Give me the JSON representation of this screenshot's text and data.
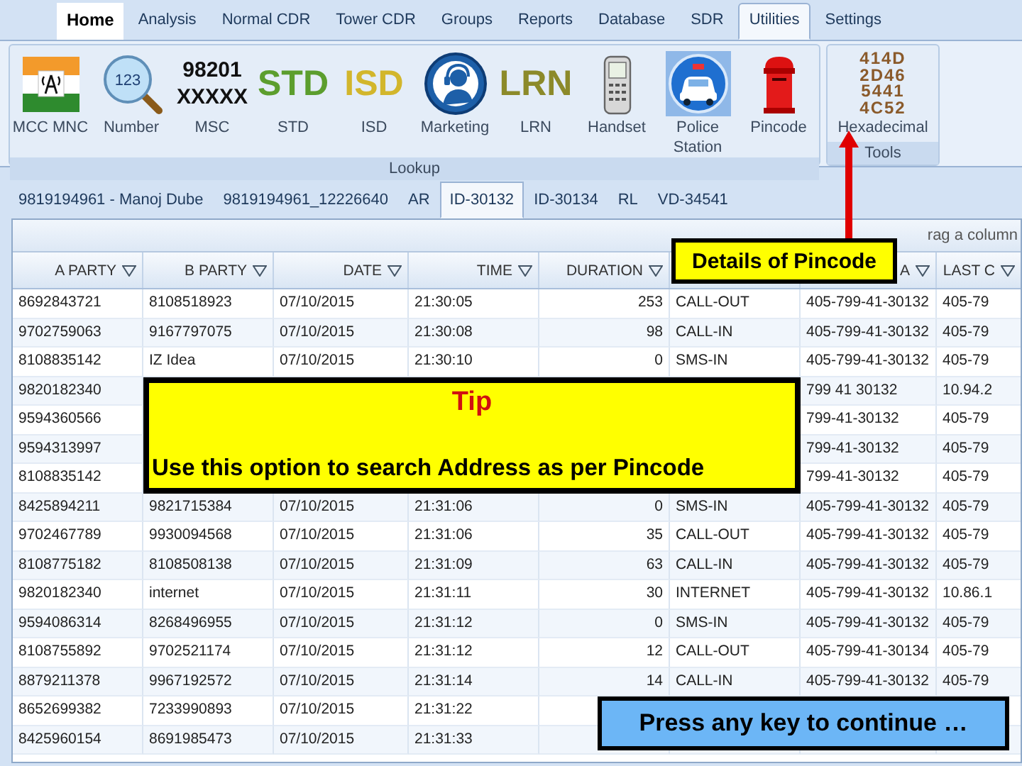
{
  "menu_tabs": [
    {
      "label": "Home",
      "selected": false,
      "highlighted": true
    },
    {
      "label": "Analysis",
      "selected": false,
      "highlighted": false
    },
    {
      "label": "Normal CDR",
      "selected": false,
      "highlighted": false
    },
    {
      "label": "Tower CDR",
      "selected": false,
      "highlighted": false
    },
    {
      "label": "Groups",
      "selected": false,
      "highlighted": false
    },
    {
      "label": "Reports",
      "selected": false,
      "highlighted": false
    },
    {
      "label": "Database",
      "selected": false,
      "highlighted": false
    },
    {
      "label": "SDR",
      "selected": false,
      "highlighted": false
    },
    {
      "label": "Utilities",
      "selected": true,
      "highlighted": false
    },
    {
      "label": "Settings",
      "selected": false,
      "highlighted": false
    }
  ],
  "ribbon_groups": [
    {
      "label": "Lookup",
      "buttons": [
        {
          "label": "MCC MNC",
          "kind": "flag"
        },
        {
          "label": "Number",
          "kind": "magnifier",
          "icon_text": [
            "123"
          ]
        },
        {
          "label": "MSC",
          "kind": "digits",
          "icon_text": [
            "98201",
            "XXXXX"
          ]
        },
        {
          "label": "STD",
          "kind": "lettering",
          "icon_text": [
            "STD"
          ],
          "color": "#5c9e2e"
        },
        {
          "label": "ISD",
          "kind": "lettering",
          "icon_text": [
            "ISD"
          ],
          "color": "#d2b62c"
        },
        {
          "label": "Marketing",
          "kind": "headset"
        },
        {
          "label": "LRN",
          "kind": "lettering",
          "icon_text": [
            "LRN"
          ],
          "color": "#8c8a2a"
        },
        {
          "label": "Handset",
          "kind": "handset"
        },
        {
          "label": "Police Station",
          "kind": "car"
        },
        {
          "label": "Pincode",
          "kind": "postbox"
        }
      ]
    },
    {
      "label": "Tools",
      "buttons": [
        {
          "label": "Hexadecimal",
          "kind": "hexgrid",
          "icon_text": [
            "414D",
            "2D46",
            "5441",
            "4C52"
          ]
        }
      ]
    }
  ],
  "document_tabs": [
    {
      "label": "9819194961 - Manoj Dube",
      "selected": false
    },
    {
      "label": "9819194961_12226640",
      "selected": false
    },
    {
      "label": "AR",
      "selected": false
    },
    {
      "label": "ID-30132",
      "selected": true
    },
    {
      "label": "ID-30134",
      "selected": false
    },
    {
      "label": "RL",
      "selected": false
    },
    {
      "label": "VD-34541",
      "selected": false
    }
  ],
  "grid": {
    "group_panel_hint": "rag a column",
    "columns": {
      "a_party": "A PARTY",
      "b_party": "B PARTY",
      "date": "DATE",
      "time": "TIME",
      "duration": "DURATION",
      "column_7": "A",
      "column_8": "LAST C"
    },
    "rows": [
      {
        "a_party": "8692843721",
        "b_party": "8108518923",
        "date": "07/10/2015",
        "time": "21:30:05",
        "duration": "253",
        "column_6": "CALL-OUT",
        "column_7": "405-799-41-30132",
        "column_8": "405-79"
      },
      {
        "a_party": "9702759063",
        "b_party": "9167797075",
        "date": "07/10/2015",
        "time": "21:30:08",
        "duration": "98",
        "column_6": "CALL-IN",
        "column_7": "405-799-41-30132",
        "column_8": "405-79"
      },
      {
        "a_party": "8108835142",
        "b_party": "IZ Idea",
        "date": "07/10/2015",
        "time": "21:30:10",
        "duration": "0",
        "column_6": "SMS-IN",
        "column_7": "405-799-41-30132",
        "column_8": "405-79"
      },
      {
        "a_party": "9820182340",
        "column_7": "799 41 30132",
        "column_8": "10.94.2"
      },
      {
        "a_party": "9594360566",
        "column_7": "799-41-30132",
        "column_8": "405-79"
      },
      {
        "a_party": "9594313997",
        "column_7": "799-41-30132",
        "column_8": "405-79"
      },
      {
        "a_party": "8108835142",
        "column_7": "799-41-30132",
        "column_8": "405-79"
      },
      {
        "a_party": "8425894211",
        "b_party": "9821715384",
        "date": "07/10/2015",
        "time": "21:31:06",
        "duration": "0",
        "column_6": "SMS-IN",
        "column_7": "405-799-41-30132",
        "column_8": "405-79"
      },
      {
        "a_party": "9702467789",
        "b_party": "9930094568",
        "date": "07/10/2015",
        "time": "21:31:06",
        "duration": "35",
        "column_6": "CALL-OUT",
        "column_7": "405-799-41-30132",
        "column_8": "405-79"
      },
      {
        "a_party": "8108775182",
        "b_party": "8108508138",
        "date": "07/10/2015",
        "time": "21:31:09",
        "duration": "63",
        "column_6": "CALL-IN",
        "column_7": "405-799-41-30132",
        "column_8": "405-79"
      },
      {
        "a_party": "9820182340",
        "b_party": "internet",
        "date": "07/10/2015",
        "time": "21:31:11",
        "duration": "30",
        "column_6": "INTERNET",
        "column_7": "405-799-41-30132",
        "column_8": "10.86.1"
      },
      {
        "a_party": "9594086314",
        "b_party": "8268496955",
        "date": "07/10/2015",
        "time": "21:31:12",
        "duration": "0",
        "column_6": "SMS-IN",
        "column_7": "405-799-41-30132",
        "column_8": "405-79"
      },
      {
        "a_party": "8108755892",
        "b_party": "9702521174",
        "date": "07/10/2015",
        "time": "21:31:12",
        "duration": "12",
        "column_6": "CALL-OUT",
        "column_7": "405-799-41-30134",
        "column_8": "405-79"
      },
      {
        "a_party": "8879211378",
        "b_party": "9967192572",
        "date": "07/10/2015",
        "time": "21:31:14",
        "duration": "14",
        "column_6": "CALL-IN",
        "column_7": "405-799-41-30132",
        "column_8": "405-79"
      },
      {
        "a_party": "8652699382",
        "b_party": "7233990893",
        "date": "07/10/2015",
        "time": "21:31:22"
      },
      {
        "a_party": "8425960154",
        "b_party": "8691985473",
        "date": "07/10/2015",
        "time": "21:31:33"
      }
    ]
  },
  "callouts": {
    "details": "Details of Pincode",
    "tip_title": "Tip",
    "tip_text": "Use this option to search Address as per Pincode",
    "continue_prompt": "Press any key to continue …"
  }
}
